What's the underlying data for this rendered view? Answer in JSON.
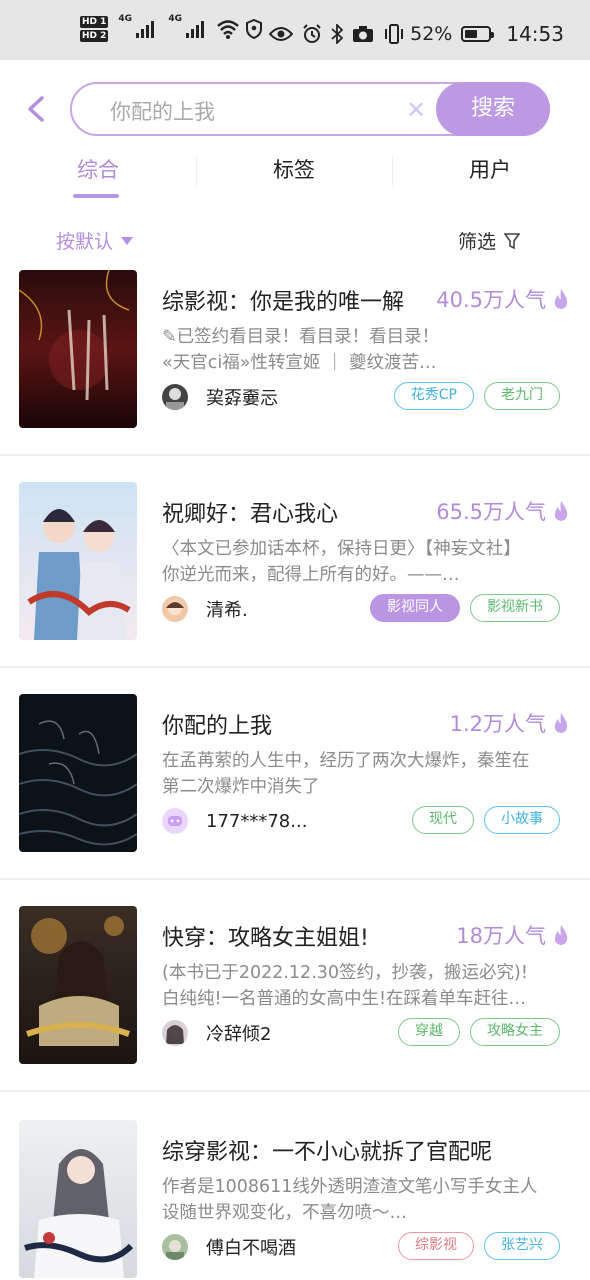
{
  "status_bar": {
    "hd1": "HD 1",
    "hd2": "HD 2",
    "net1": "4G",
    "net2": "4G",
    "battery_pct": "52%",
    "battery_level": 0.52,
    "time": "14:53"
  },
  "search": {
    "query": "你配的上我",
    "button_label": "搜索"
  },
  "tabs": [
    {
      "label": "综合",
      "active": true
    },
    {
      "label": "标签",
      "active": false
    },
    {
      "label": "用户",
      "active": false
    }
  ],
  "sort_label": "按默认",
  "filter_label": "筛选",
  "items": [
    {
      "title": "综影视：你是我的唯一解",
      "popularity": "40.5万人气",
      "desc_line1": "✎已签约看目录！看目录！看目录！",
      "desc_line2": "«天官ci福»性转宣姬 ｜ 夔纹渡苦…",
      "author": "巭孬嫑忈",
      "tags": [
        {
          "label": "花秀CP",
          "style": "cyan"
        },
        {
          "label": "老九门",
          "style": "green"
        }
      ]
    },
    {
      "title": "祝卿好：君心我心",
      "popularity": "65.5万人气",
      "desc_line1": "〈本文已参加话本杯，保持日更〉【神妄文社】",
      "desc_line2": "你逆光而来，配得上所有的好。——…",
      "author": "清希.",
      "tags": [
        {
          "label": "影视同人",
          "style": "purple"
        },
        {
          "label": "影视新书",
          "style": "green"
        }
      ]
    },
    {
      "title": "你配的上我",
      "popularity": "1.2万人气",
      "desc_line1": "在孟苒萦的人生中，经历了两次大爆炸，秦笙在",
      "desc_line2": "第二次爆炸中消失了",
      "author": "177***78...",
      "tags": [
        {
          "label": "现代",
          "style": "green"
        },
        {
          "label": "小故事",
          "style": "cyan"
        }
      ]
    },
    {
      "title": "快穿：攻略女主姐姐!",
      "popularity": "18万人气",
      "desc_line1": "(本书已于2022.12.30签约，抄袭，搬运必究)!",
      "desc_line2": "白纯纯!一名普通的女高中生!在踩着单车赶往…",
      "author": "冷辞倾2",
      "tags": [
        {
          "label": "穿越",
          "style": "green"
        },
        {
          "label": "攻略女主",
          "style": "green"
        }
      ]
    },
    {
      "title": "综穿影视：一不小心就拆了官配呢",
      "popularity": "",
      "desc_line1": "作者是1008611线外透明渣渣文笔小写手女主人",
      "desc_line2": "设随世界观变化，不喜勿喷～…",
      "author": "傅白不喝酒",
      "tags": [
        {
          "label": "综影视",
          "style": "red"
        },
        {
          "label": "张艺兴",
          "style": "cyan"
        }
      ]
    }
  ]
}
